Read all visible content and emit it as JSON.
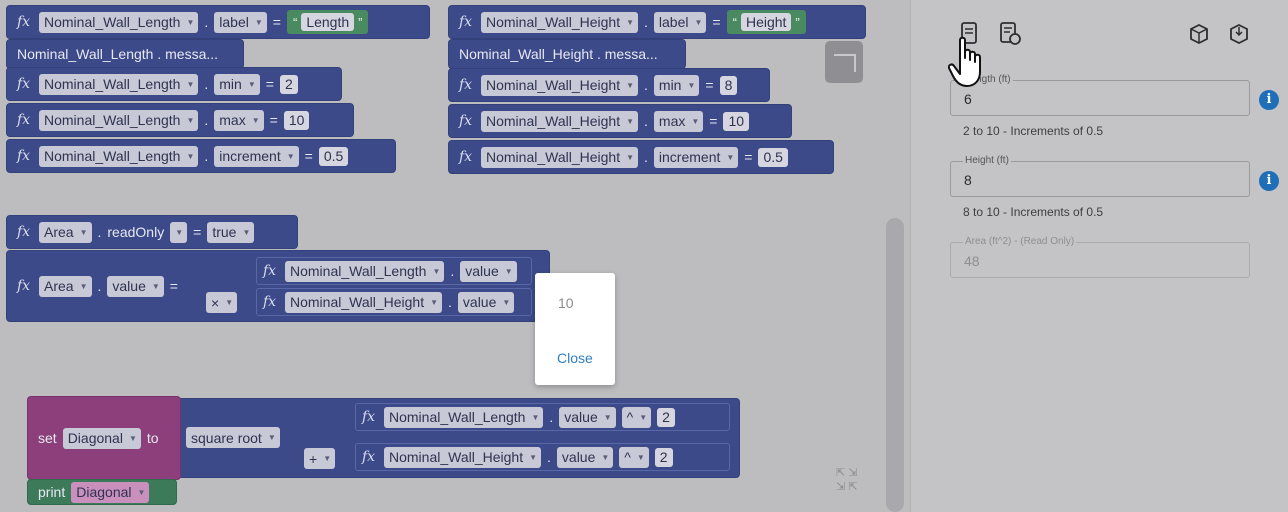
{
  "blocks": {
    "fx": "fx",
    "length": {
      "var": "Nominal_Wall_Length",
      "label_prop": "label",
      "label_value": "Length",
      "message": "Nominal_Wall_Length . messa...",
      "min_prop": "min",
      "min_value": "2",
      "max_prop": "max",
      "max_value": "10",
      "inc_prop": "increment",
      "inc_value": "0.5"
    },
    "height": {
      "var": "Nominal_Wall_Height",
      "label_prop": "label",
      "label_value": "Height",
      "message": "Nominal_Wall_Height . messa...",
      "min_prop": "min",
      "min_value": "8",
      "max_prop": "max",
      "max_value": "10",
      "inc_prop": "increment",
      "inc_value": "0.5"
    },
    "area": {
      "var": "Area",
      "readonly_prop": "readOnly",
      "readonly_value": "true",
      "value_prop": "value",
      "multiply_op": "×"
    },
    "diagonal": {
      "set_label": "set",
      "var": "Diagonal",
      "to_label": "to",
      "func": "square root",
      "plus_op": "+",
      "value_prop": "value",
      "pow_op": "^",
      "exponent": "2",
      "print_label": "print"
    },
    "dot": ".",
    "equals": "=",
    "open_quote": "“",
    "close_quote": "”"
  },
  "dialog": {
    "value": "10",
    "close_label": "Close"
  },
  "panel": {
    "fields": [
      {
        "label": "Length (ft)",
        "value": "6",
        "hint": "2 to 10 - Increments of 0.5"
      },
      {
        "label": "Height (ft)",
        "value": "8",
        "hint": "8 to 10 - Increments of 0.5"
      },
      {
        "label": "Area (ft^2) - (Read Only)",
        "value": "48"
      }
    ]
  },
  "icons": {
    "doc": "document-icon",
    "doc_refresh": "document-refresh-icon",
    "cube_up": "cube-export-icon",
    "cube_down": "cube-import-icon",
    "info": "info-icon",
    "cursor": "hand-pointer-icon"
  },
  "colors": {
    "block": "#3d4a8a",
    "purple_block": "#8c3f7a",
    "green_block": "#3d7a5a",
    "info": "#1e6fb8",
    "link": "#2f7fc0"
  }
}
